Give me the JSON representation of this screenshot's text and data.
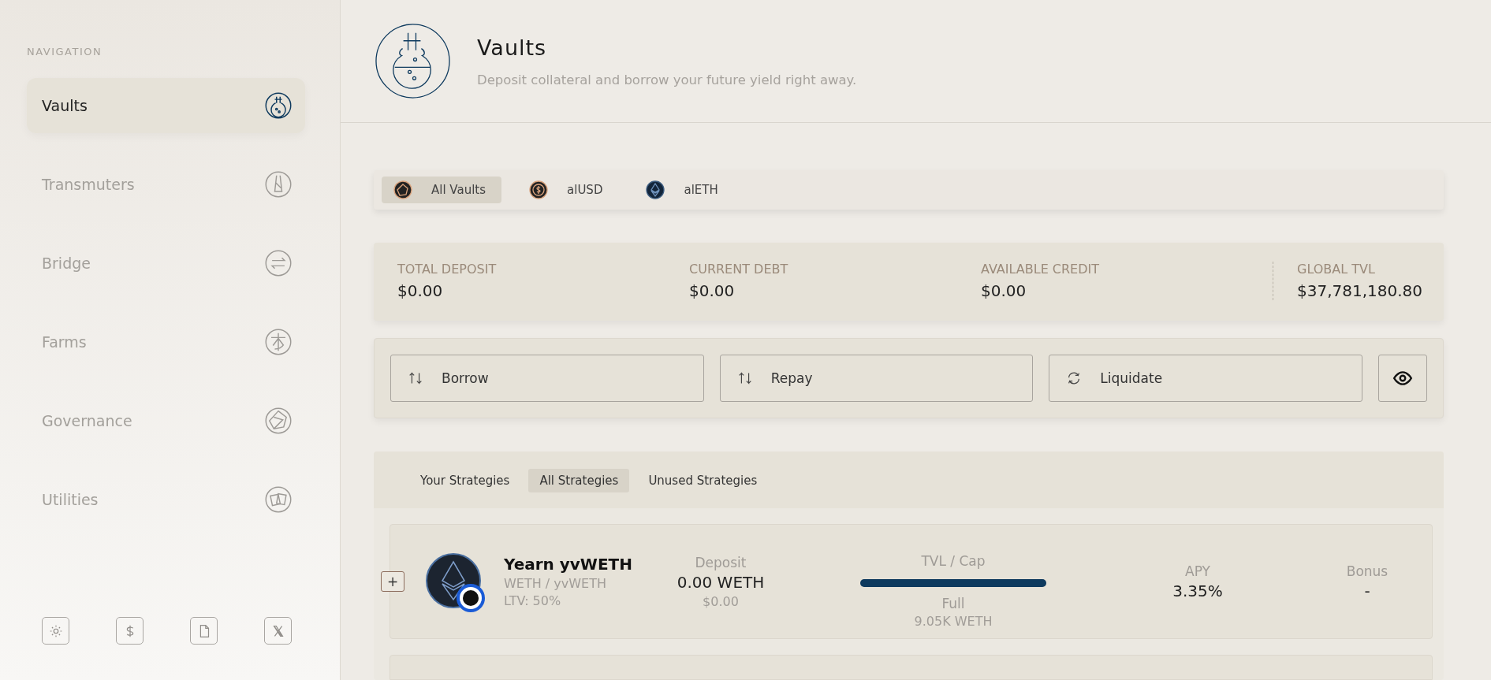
{
  "sidebar": {
    "heading": "NAVIGATION",
    "items": [
      {
        "label": "Vaults",
        "selected": true
      },
      {
        "label": "Transmuters",
        "selected": false
      },
      {
        "label": "Bridge",
        "selected": false
      },
      {
        "label": "Farms",
        "selected": false
      },
      {
        "label": "Governance",
        "selected": false
      },
      {
        "label": "Utilities",
        "selected": false
      }
    ]
  },
  "header": {
    "title": "Vaults",
    "subtitle": "Deposit collateral and borrow your future yield right away."
  },
  "vault_tabs": [
    {
      "label": "All Vaults",
      "selected": true
    },
    {
      "label": "alUSD",
      "selected": false
    },
    {
      "label": "alETH",
      "selected": false
    }
  ],
  "stats": [
    {
      "label": "TOTAL DEPOSIT",
      "value": "$0.00"
    },
    {
      "label": "CURRENT DEBT",
      "value": "$0.00"
    },
    {
      "label": "AVAILABLE CREDIT",
      "value": "$0.00"
    },
    {
      "label": "GLOBAL TVL",
      "value": "$37,781,180.80"
    }
  ],
  "actions": [
    {
      "label": "Borrow",
      "kind": "swap"
    },
    {
      "label": "Repay",
      "kind": "swap"
    },
    {
      "label": "Liquidate",
      "kind": "cycle"
    }
  ],
  "strategy_tabs": [
    {
      "label": "Your Strategies",
      "selected": false
    },
    {
      "label": "All Strategies",
      "selected": true
    },
    {
      "label": "Unused Strategies",
      "selected": false
    }
  ],
  "strategies": [
    {
      "expand": "+",
      "name": "Yearn yvWETH",
      "pair": "WETH / yvWETH",
      "ltv": "LTV: 50%",
      "deposit_label": "Deposit",
      "deposit": "0.00 WETH",
      "deposit_usd": "$0.00",
      "tvl_label": "TVL / Cap",
      "level": 1,
      "tvl_status": "Full",
      "cap": "9.05K WETH",
      "apy_label": "APY",
      "apy": "3.35%",
      "bonus_label": "Bonus",
      "bonus": "-"
    }
  ]
}
